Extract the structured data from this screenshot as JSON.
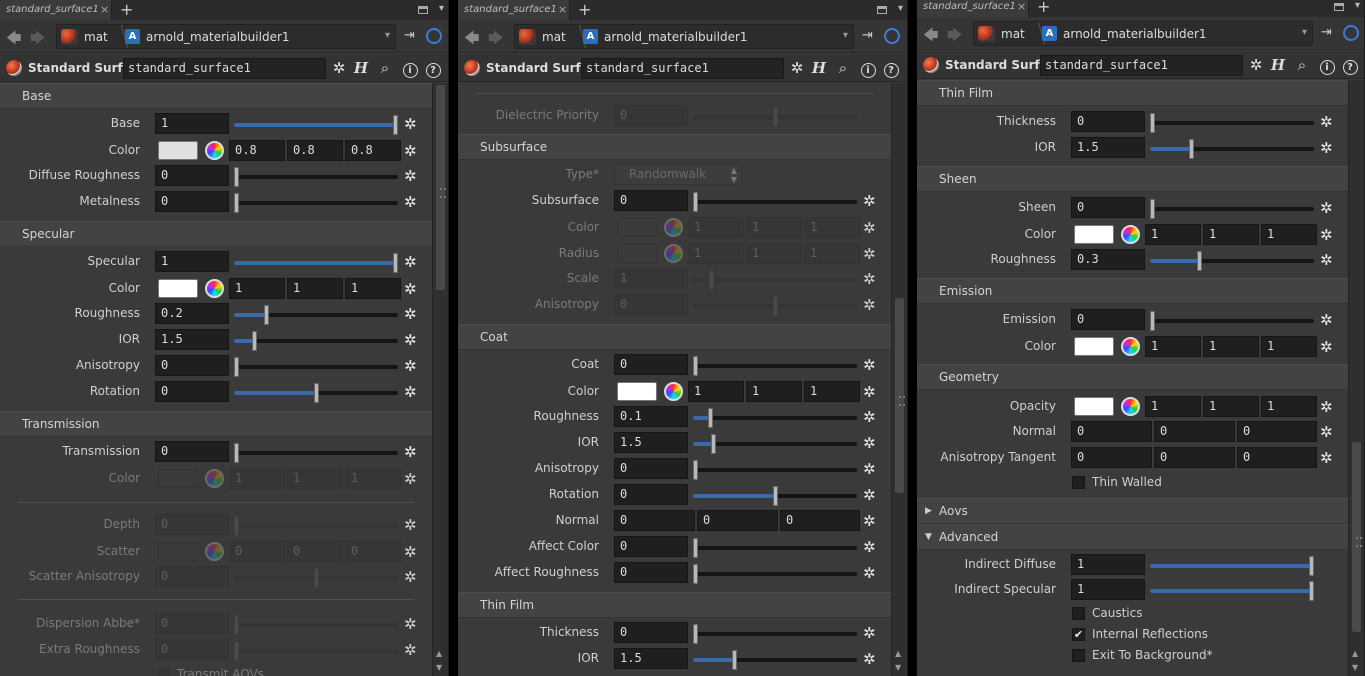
{
  "app": {
    "tab_label": "standard_surface1",
    "close_glyph": "×",
    "add_glyph": "+",
    "menu_glyph": "▾",
    "nav_back_glyph": "🡄",
    "nav_fwd_glyph": "🡆",
    "path_root": "mat",
    "path_node": "arnold_materialbuilder1",
    "path_node_glyph": "A",
    "node_type": "Standard Surface",
    "node_name": "standard_surface1",
    "pin_glyph": "⇥",
    "gear_glyph": "✲",
    "h_glyph": "H",
    "search_glyph": "⌕",
    "info_glyph": "i",
    "help_glyph": "?",
    "check_glyph": "✔",
    "tri_right": "▶",
    "tri_down": "▼",
    "dd_up": "▲",
    "dd_down": "▼",
    "accent": "#3a6ba8"
  },
  "panel1": {
    "base_header": "Base",
    "base_label": "Base",
    "base_value": "1",
    "color_label": "Color",
    "color_r": "0.8",
    "color_g": "0.8",
    "color_b": "0.8",
    "diffuse_roughness_label": "Diffuse Roughness",
    "diffuse_roughness_value": "0",
    "metalness_label": "Metalness",
    "metalness_value": "0",
    "specular_header": "Specular",
    "specular_label": "Specular",
    "specular_value": "1",
    "spec_color_label": "Color",
    "spec_color_r": "1",
    "spec_color_g": "1",
    "spec_color_b": "1",
    "roughness_label": "Roughness",
    "roughness_value": "0.2",
    "ior_label": "IOR",
    "ior_value": "1.5",
    "anisotropy_label": "Anisotropy",
    "anisotropy_value": "0",
    "rotation_label": "Rotation",
    "rotation_value": "0",
    "transmission_header": "Transmission",
    "transmission_label": "Transmission",
    "transmission_value": "0",
    "trans_color_label": "Color",
    "trans_color_r": "1",
    "trans_color_g": "1",
    "trans_color_b": "1",
    "depth_label": "Depth",
    "depth_value": "0",
    "scatter_label": "Scatter",
    "scatter_r": "0",
    "scatter_g": "0",
    "scatter_b": "0",
    "scatter_aniso_label": "Scatter Anisotropy",
    "scatter_aniso_value": "0",
    "dispersion_label": "Dispersion Abbe*",
    "dispersion_value": "0",
    "extra_roughness_label": "Extra Roughness",
    "extra_roughness_value": "0",
    "transmit_aovs_label": "Transmit AOVs"
  },
  "panel2": {
    "dielectric_priority_label": "Dielectric Priority",
    "dielectric_priority_value": "0",
    "subsurface_header": "Subsurface",
    "type_label": "Type*",
    "type_value": "Randomwalk",
    "subsurface_label": "Subsurface",
    "subsurface_value": "0",
    "ss_color_label": "Color",
    "ss_color_r": "1",
    "ss_color_g": "1",
    "ss_color_b": "1",
    "radius_label": "Radius",
    "radius_r": "1",
    "radius_g": "1",
    "radius_b": "1",
    "scale_label": "Scale",
    "scale_value": "1",
    "ss_anisotropy_label": "Anisotropy",
    "ss_anisotropy_value": "0",
    "coat_header": "Coat",
    "coat_label": "Coat",
    "coat_value": "0",
    "coat_color_label": "Color",
    "coat_color_r": "1",
    "coat_color_g": "1",
    "coat_color_b": "1",
    "coat_roughness_label": "Roughness",
    "coat_roughness_value": "0.1",
    "coat_ior_label": "IOR",
    "coat_ior_value": "1.5",
    "coat_anisotropy_label": "Anisotropy",
    "coat_anisotropy_value": "0",
    "coat_rotation_label": "Rotation",
    "coat_rotation_value": "0",
    "coat_normal_label": "Normal",
    "coat_normal_x": "0",
    "coat_normal_y": "0",
    "coat_normal_z": "0",
    "affect_color_label": "Affect Color",
    "affect_color_value": "0",
    "affect_roughness_label": "Affect Roughness",
    "affect_roughness_value": "0",
    "thinfilm_header": "Thin Film",
    "thickness_label": "Thickness",
    "thickness_value": "0",
    "tf_ior_label": "IOR",
    "tf_ior_value": "1.5"
  },
  "panel3": {
    "thinfilm_header": "Thin Film",
    "thickness_label": "Thickness",
    "thickness_value": "0",
    "ior_label": "IOR",
    "ior_value": "1.5",
    "sheen_header": "Sheen",
    "sheen_label": "Sheen",
    "sheen_value": "0",
    "sheen_color_label": "Color",
    "sheen_color_r": "1",
    "sheen_color_g": "1",
    "sheen_color_b": "1",
    "sheen_roughness_label": "Roughness",
    "sheen_roughness_value": "0.3",
    "emission_header": "Emission",
    "emission_label": "Emission",
    "emission_value": "0",
    "em_color_label": "Color",
    "em_color_r": "1",
    "em_color_g": "1",
    "em_color_b": "1",
    "geometry_header": "Geometry",
    "opacity_label": "Opacity",
    "opacity_r": "1",
    "opacity_g": "1",
    "opacity_b": "1",
    "normal_label": "Normal",
    "normal_x": "0",
    "normal_y": "0",
    "normal_z": "0",
    "aniso_tangent_label": "Anisotropy Tangent",
    "aniso_tangent_x": "0",
    "aniso_tangent_y": "0",
    "aniso_tangent_z": "0",
    "thin_walled_label": "Thin Walled",
    "aovs_header": "Aovs",
    "advanced_header": "Advanced",
    "indirect_diffuse_label": "Indirect Diffuse",
    "indirect_diffuse_value": "1",
    "indirect_specular_label": "Indirect Specular",
    "indirect_specular_value": "1",
    "caustics_label": "Caustics",
    "internal_reflections_label": "Internal Reflections",
    "exit_to_background_label": "Exit To Background*"
  }
}
